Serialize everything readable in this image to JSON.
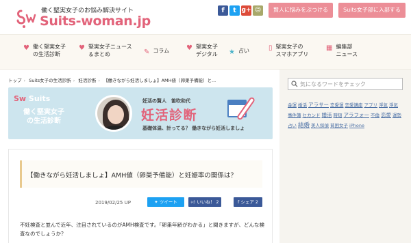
{
  "header": {
    "tagline": "働く堅実女子のお悩み解決サイト",
    "logo_text": "Suits-woman.jp",
    "social": [
      {
        "icon": "facebook-icon",
        "glyph": "f"
      },
      {
        "icon": "twitter-icon",
        "glyph": "t"
      },
      {
        "icon": "google-plus-icon",
        "glyph": "g+"
      },
      {
        "icon": "rss-icon",
        "glyph": "☺"
      }
    ],
    "button_consult": "賢人に悩みをぶつける",
    "button_join": "Suits女子部に入部する"
  },
  "nav": {
    "items": [
      {
        "label": "働く堅実女子\nの生活診断",
        "icon": "♥",
        "color": "#e2637a"
      },
      {
        "label": "堅実女子ニュース\n＆まとめ",
        "icon": "♥",
        "color": "#e2637a"
      },
      {
        "label": "コラム",
        "icon": "✎",
        "color": "#e2637a"
      },
      {
        "label": "堅実女子\nデジタル",
        "icon": "♥",
        "color": "#e2637a"
      },
      {
        "label": "占い",
        "icon": "★",
        "color": "#4bb3c9"
      },
      {
        "label": "堅実女子の\nスマホアプリ",
        "icon": "▯",
        "color": "#e2637a"
      },
      {
        "label": "編集部\nニュース",
        "icon": "▦",
        "color": "#e2637a"
      }
    ]
  },
  "breadcrumb": [
    "トップ",
    "Suits女子の生活診断",
    "妊活診断",
    "【働きながら妊活しましょ】AMH値（卵巣予備能）と..."
  ],
  "banner": {
    "logo": "Suits",
    "sub_line1": "働く堅実女子",
    "sub_line2": "の生活診断",
    "author": "妊活の賢人　笛吹和代",
    "title": "妊活診断",
    "tagline": "基礎体温、計ってる？ 働きながら妊活しましょ",
    "bg": "#cde5ee"
  },
  "article": {
    "title": "【働きながら妊活しましょ】AMH値（卵巣予備能）と妊娠率の関係は？",
    "date": "2019/02/25 UP",
    "tweet": "ツイート",
    "like": "いいね！ 2",
    "share": "シェア 2",
    "text": "不妊検査と並んで近年、注目されているのがAMH検査です。「卵巣年齢がわかる」と聞きますが、どんな検査なのでしょうか？"
  },
  "sidebar": {
    "search_placeholder": "気になるワードをチェック",
    "tags": [
      {
        "t": "金運",
        "s": ""
      },
      {
        "t": "婚活",
        "s": ""
      },
      {
        "t": "アラサー",
        "s": "md"
      },
      {
        "t": "恋愛運",
        "s": ""
      },
      {
        "t": "恋愛講座",
        "s": ""
      },
      {
        "t": "アプリ",
        "s": ""
      },
      {
        "t": "浮気",
        "s": ""
      },
      {
        "t": "浮気",
        "s": ""
      },
      {
        "t": "事件簿",
        "s": ""
      },
      {
        "t": "セカンド",
        "s": ""
      },
      {
        "t": "婚活",
        "s": "md"
      },
      {
        "t": "時短",
        "s": ""
      },
      {
        "t": "アラフォー",
        "s": "md"
      },
      {
        "t": "不倫",
        "s": ""
      },
      {
        "t": "恋愛",
        "s": "md"
      },
      {
        "t": "運勢",
        "s": ""
      },
      {
        "t": "占い",
        "s": ""
      },
      {
        "t": "結婚",
        "s": "lg"
      },
      {
        "t": "美人探偵",
        "s": ""
      },
      {
        "t": "貧困女子",
        "s": ""
      },
      {
        "t": "iPhone",
        "s": ""
      }
    ]
  }
}
